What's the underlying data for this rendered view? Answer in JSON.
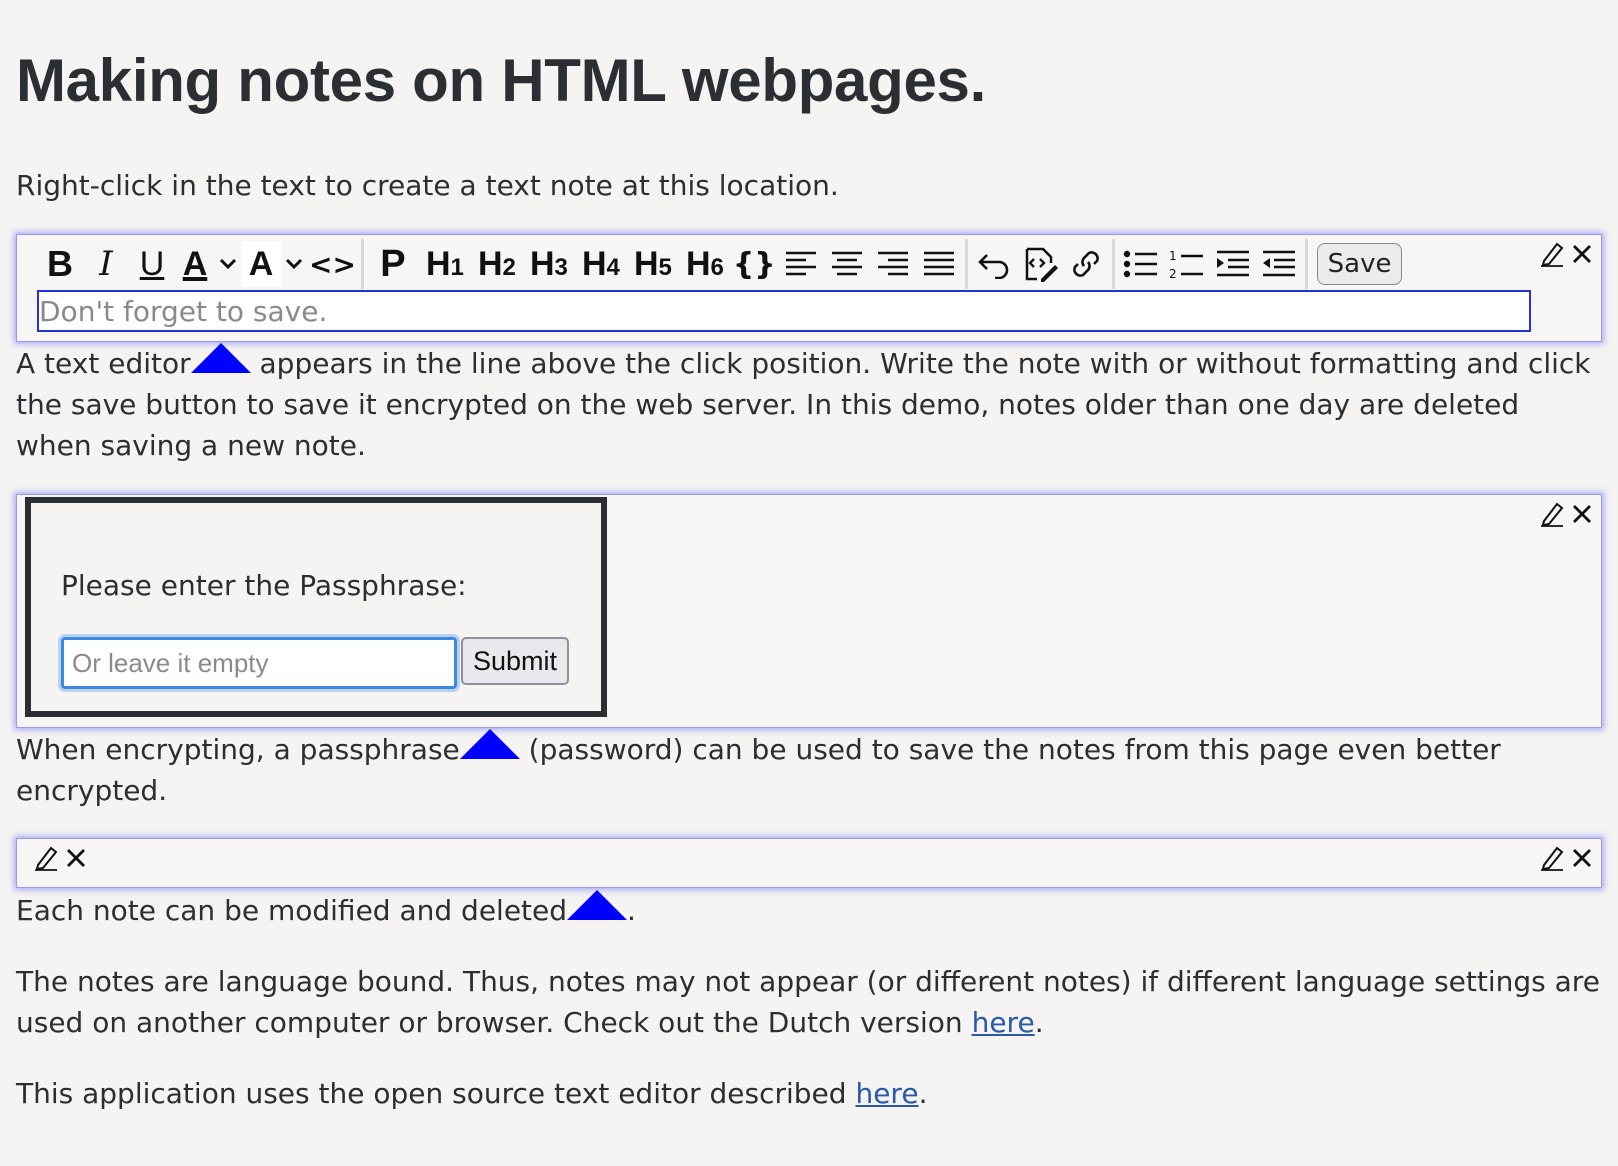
{
  "page": {
    "title": "Making notes on HTML webpages.",
    "intro": "Right-click in the text to create a text note at this location.",
    "para1_a": "A text editor",
    "para1_b": " appears in the line above the click position. Write the note with or without formatting and click the save button to save it encrypted on the web server. In this demo, notes older than one day are deleted when saving a new note.",
    "para2_a": "When encrypting, a passphrase",
    "para2_b": " (password) can be used to save the notes from this page even better encrypted.",
    "para3_a": "Each note can be modified and deleted",
    "para3_b": ".",
    "para4_a": "The notes are language bound. Thus, notes may not appear (or different notes) if different language settings are used on another computer or browser. Check out the Dutch version ",
    "para4_link": "here",
    "para4_b": ".",
    "para5_a": "This application uses the open source text editor described ",
    "para5_link": "here",
    "para5_b": "."
  },
  "editor": {
    "toolbar": {
      "bold": "B",
      "italic": "I",
      "underline": "U",
      "font_color": "A",
      "bg_color": "A",
      "code": "<>",
      "paragraph": "P",
      "h1": "H",
      "h1n": "1",
      "h2": "H",
      "h2n": "2",
      "h3": "H",
      "h3n": "3",
      "h4": "H",
      "h4n": "4",
      "h5": "H",
      "h5n": "5",
      "h6": "H",
      "h6n": "6",
      "codeblock": "{}"
    },
    "save_label": "Save",
    "placeholder": "Don't forget to save."
  },
  "passphrase": {
    "label": "Please enter the Passphrase:",
    "placeholder": "Or leave it empty",
    "submit_label": "Submit"
  },
  "icons": {
    "edit": "pencil-icon",
    "close": "close-icon",
    "marker": "note-marker-triangle"
  },
  "colors": {
    "marker": "#0000ff",
    "note_glow": "#6e6eff",
    "link": "#2a5aa6"
  }
}
